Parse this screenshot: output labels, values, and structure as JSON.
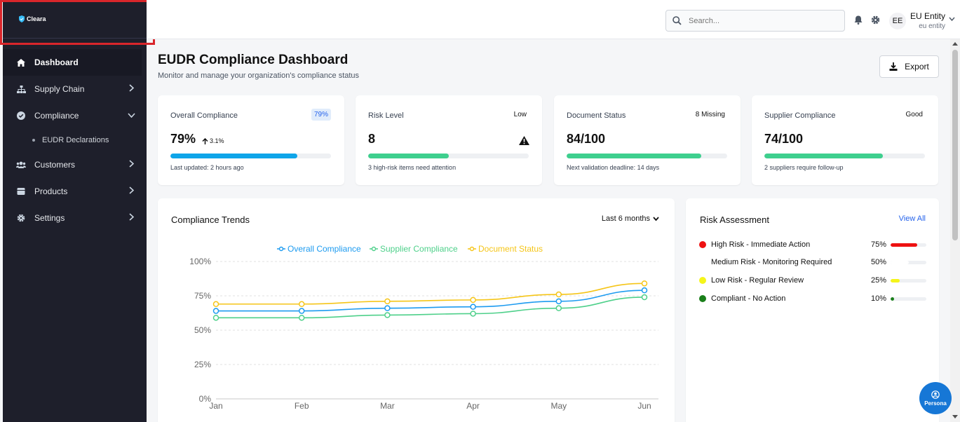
{
  "brand": {
    "name": "Cleara"
  },
  "sidebar": {
    "items": [
      {
        "label": "Dashboard",
        "icon": "home-icon"
      },
      {
        "label": "Supply Chain",
        "icon": "sitemap-icon"
      },
      {
        "label": "Compliance",
        "icon": "check-circle-icon"
      },
      {
        "label": "Customers",
        "icon": "users-icon"
      },
      {
        "label": "Products",
        "icon": "box-icon"
      },
      {
        "label": "Settings",
        "icon": "gear-icon"
      }
    ],
    "sub_items": [
      {
        "label": "EUDR Declarations"
      }
    ]
  },
  "header": {
    "search_placeholder": "Search...",
    "avatar_initials": "EE",
    "user_name": "EU Entity",
    "user_role": "eu entity"
  },
  "main": {
    "title": "EUDR Compliance Dashboard",
    "subtitle": "Monitor and manage your organization's compliance status",
    "export_label": "Export"
  },
  "cards": [
    {
      "label": "Overall Compliance",
      "badge": "79%",
      "value": "79%",
      "trend": "3.1%",
      "progress": 0.79,
      "color": "#0ea5e9",
      "note": "Last updated: 2 hours ago"
    },
    {
      "label": "Risk Level",
      "badge": "Low",
      "value": "8",
      "progress": 0.5,
      "color": "#3ecf8e",
      "note": "3 high-risk items need attention"
    },
    {
      "label": "Document Status",
      "badge": "8 Missing",
      "value": "84/100",
      "progress": 0.84,
      "color": "#3ecf8e",
      "note": "Next validation deadline: 14 days"
    },
    {
      "label": "Supplier Compliance",
      "badge": "Good",
      "value": "74/100",
      "progress": 0.74,
      "color": "#3ecf8e",
      "note": "2 suppliers require follow-up"
    }
  ],
  "trends": {
    "title": "Compliance Trends",
    "period": "Last 6 months"
  },
  "risk": {
    "title": "Risk Assessment",
    "view_all": "View All",
    "items": [
      {
        "label": "High Risk - Immediate Action",
        "pct": "75%",
        "value": 0.75,
        "color": "#ee1111"
      },
      {
        "label": "Medium Risk - Monitoring Required",
        "pct": "50%",
        "value": 0.5,
        "color": "#ffffff"
      },
      {
        "label": "Low Risk - Regular Review",
        "pct": "25%",
        "value": 0.25,
        "color": "#f5f51a"
      },
      {
        "label": "Compliant - No Action",
        "pct": "10%",
        "value": 0.1,
        "color": "#1a7f1a"
      }
    ]
  },
  "persona": {
    "label": "Persona"
  },
  "chart_data": {
    "type": "line",
    "categories": [
      "Jan",
      "Feb",
      "Mar",
      "Apr",
      "May",
      "Jun"
    ],
    "series": [
      {
        "name": "Overall Compliance",
        "values": [
          64,
          64,
          66,
          67,
          71,
          79
        ],
        "color": "#1d9bf0"
      },
      {
        "name": "Supplier Compliance",
        "values": [
          59,
          59,
          61,
          62,
          66,
          74
        ],
        "color": "#4ed08a"
      },
      {
        "name": "Document Status",
        "values": [
          69,
          69,
          71,
          72,
          76,
          84
        ],
        "color": "#f5c518"
      }
    ],
    "yticks": [
      "0%",
      "25%",
      "50%",
      "75%",
      "100%"
    ],
    "ylim": [
      0,
      100
    ],
    "grid": true,
    "legend_position": "top"
  }
}
